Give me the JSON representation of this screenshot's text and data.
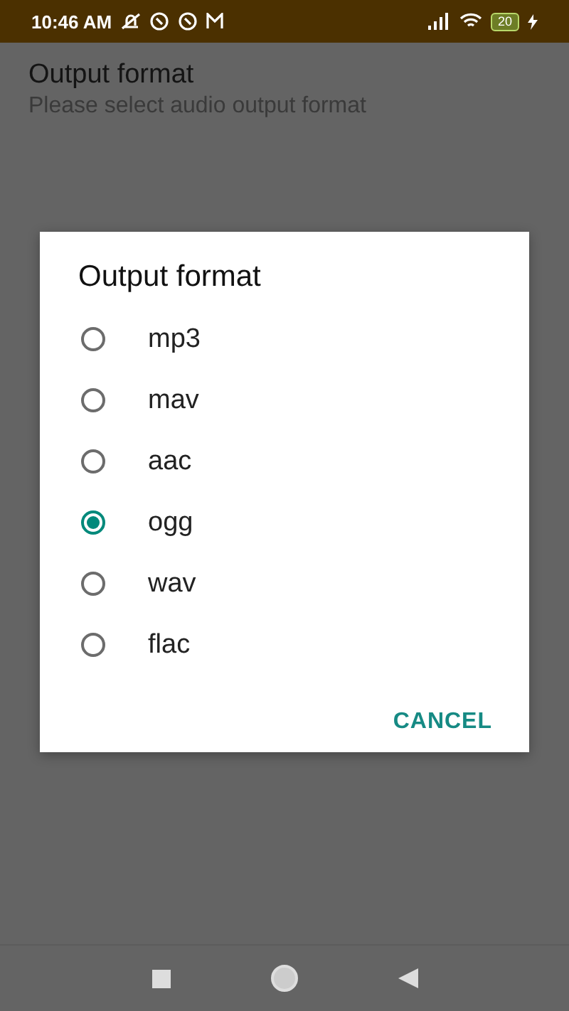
{
  "status_bar": {
    "time": "10:46 AM",
    "battery": "20"
  },
  "setting": {
    "title": "Output format",
    "summary": "Please select audio output format"
  },
  "dialog": {
    "title": "Output format",
    "options": [
      {
        "label": "mp3",
        "selected": false
      },
      {
        "label": "mav",
        "selected": false
      },
      {
        "label": "aac",
        "selected": false
      },
      {
        "label": "ogg",
        "selected": true
      },
      {
        "label": "wav",
        "selected": false
      },
      {
        "label": "flac",
        "selected": false
      }
    ],
    "buttons": [
      "CANCEL"
    ]
  }
}
